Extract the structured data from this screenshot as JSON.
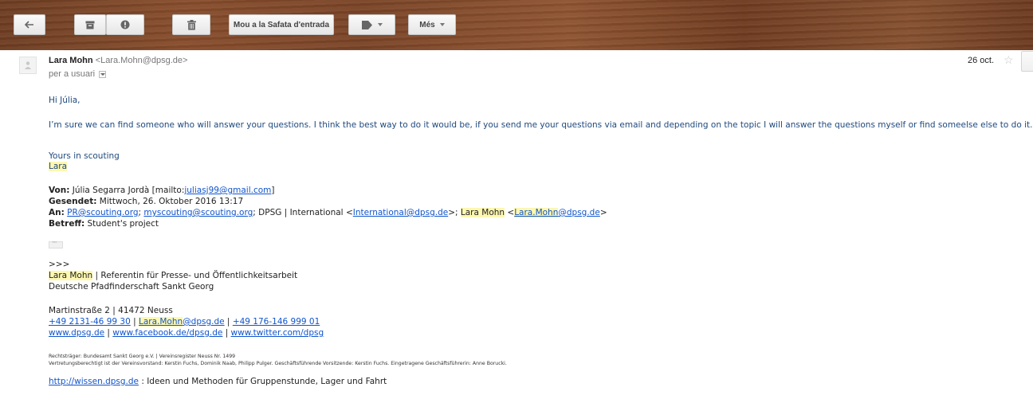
{
  "toolbar": {
    "archive_label": "",
    "move_inbox_label": "Mou a la Safata d'entrada",
    "more_label": "Més"
  },
  "header": {
    "sender_name": "Lara Mohn",
    "sender_email": "<Lara.Mohn@dpsg.de>",
    "recipients": "per a usuari",
    "date": "26 oct."
  },
  "body": {
    "greeting": "Hi Júlia,",
    "paragraph": "I’m sure we can find someone who will answer your questions. I think the best way to do it would be, if you send me your questions via email and depending on the topic I will answer the questions myself or find someelse else to do it.",
    "closing": "Yours in scouting",
    "sign_name": "Lara"
  },
  "quoted": {
    "von_label": "Von:",
    "von_text": " Júlia Segarra Jordà [mailto:",
    "von_link": "juliasj99@gmail.com",
    "von_end": "]",
    "gesendet_label": "Gesendet:",
    "gesendet_text": " Mittwoch, 26. Oktober 2016 13:17",
    "an_label": "An:",
    "an_link1": "PR@scouting.org",
    "an_sep1": "; ",
    "an_link2": "myscouting@scouting.org",
    "an_text2": "; DPSG | International <",
    "an_link3": "International@dpsg.de",
    "an_text3": ">; ",
    "an_name_hl": "Lara Mohn",
    "an_text4": " <",
    "an_link4": "Lara.Mohn",
    "an_link4b": "@dpsg.de",
    "an_end": ">",
    "betreff_label": "Betreff:",
    "betreff_text": " Student's project"
  },
  "signature": {
    "marker": ">>>",
    "name": "Lara Mohn",
    "role": " | Referentin für Presse- und Öffentlichkeitsarbeit",
    "org": "Deutsche Pfadfinderschaft Sankt Georg",
    "address": "Martinstraße 2 | 41472 Neuss",
    "phone1": "+49 2131-46 99 30",
    "sep": " | ",
    "email_name": "Lara.Mohn",
    "email_domain": "@dpsg.de",
    "phone2": "+49 176-146 999 01",
    "web1": "www.dpsg.de",
    "web2": "www.facebook.de/dpsg.de",
    "web3": "www.twitter.com/dpsg",
    "legal1": "Rechtsträger: Bundesamt Sankt Georg e.V. | Vereinsregister Neuss Nr. 1499",
    "legal2": "Vertretungsberechtigt ist der Vereinsvorstand: Kerstin Fuchs, Dominik Naab, Philipp Pulger. Geschäftsführende Vorsitzende: Kerstin Fuchs. Eingetragene Geschäftsführerin: Anne Borucki.",
    "wissen_link": "http://wissen.dpsg.de",
    "wissen_text": " : Ideen und Methoden für Gruppenstunde, Lager und Fahrt"
  }
}
